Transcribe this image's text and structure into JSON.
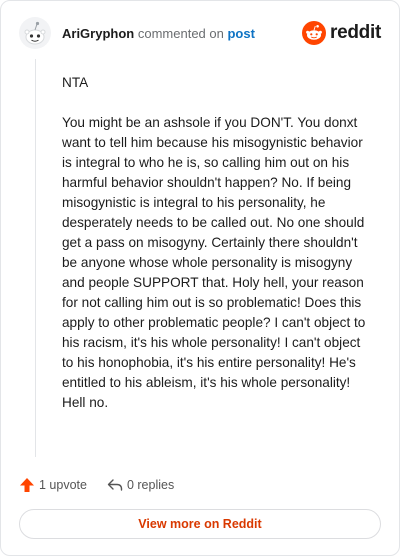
{
  "comment": {
    "username": "AriGryphon",
    "verb": "commented on",
    "post_link": "post",
    "paragraphs": [
      "NTA",
      "You might be an ashsole if you DON'T. You donxt want to tell him because his misogynistic behavior is integral to who he is, so calling him out on his harmful behavior shouldn't happen? No. If being misogynistic is integral to his personality, he desperately needs to be called out. No one should get a pass on misogyny. Certainly there shouldn't be anyone whose whole personality is misogyny and people SUPPORT that. Holy hell, your reason for not calling him out is so problematic! Does this apply to other problematic people? I can't object to his racism, it's his whole personality! I can't object to his honophobia, it's his entire personality! He's entitled to his ableism, it's his whole personality! Hell no."
    ]
  },
  "brand": {
    "wordmark": "reddit",
    "icon": "reddit-logo-icon",
    "color": "#ff4500"
  },
  "actions": {
    "upvotes": "1 upvote",
    "upvote_icon": "upvote-arrow-icon",
    "replies": "0 replies",
    "reply_icon": "reply-arrow-icon"
  },
  "footer": {
    "view_more": "View more on Reddit"
  },
  "colors": {
    "accent": "#ff4500",
    "link": "#0e73c4",
    "view_more_text": "#d93900"
  }
}
